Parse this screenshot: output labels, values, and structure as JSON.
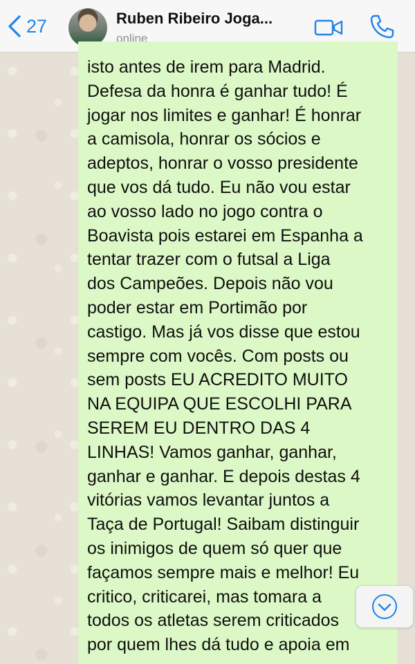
{
  "header": {
    "back_count": "27",
    "contact_name": "Ruben Ribeiro Joga...",
    "status": "online"
  },
  "icons": {
    "back": "chevron-left-icon",
    "video": "video-camera-icon",
    "call": "phone-icon",
    "scroll": "chevron-down-circle-icon"
  },
  "colors": {
    "accent": "#1f84e6",
    "bubble": "#dcf8c6",
    "header_bg": "#f7f7f7"
  },
  "message": {
    "text": "isto antes de irem para Madrid.\nDefesa da honra é ganhar tudo! É\njogar nos limites e ganhar! É honrar\na camisola, honrar os sócios e\nadeptos, honrar o vosso presidente\nque vos dá tudo. Eu não vou estar\nao vosso lado no jogo contra o\nBoavista pois estarei em Espanha a\ntentar trazer com o futsal a Liga\ndos Campeões. Depois não vou\npoder estar em Portimão por\ncastigo. Mas já vos disse que estou\nsempre com vocês. Com posts ou\nsem posts EU ACREDITO MUITO\nNA EQUIPA QUE ESCOLHI PARA\nSEREM EU DENTRO DAS 4\nLINHAS! Vamos ganhar, ganhar,\nganhar e ganhar. E depois destas 4\nvitórias vamos levantar juntos a\nTaça de Portugal! Saibam distinguir\nos inimigos de quem só quer que\nfaçamos sempre mais e melhor! Eu\ncritico, criticarei, mas tomara a\ntodos os atletas serem criticados\npor quem lhes dá tudo e apoia em"
  }
}
